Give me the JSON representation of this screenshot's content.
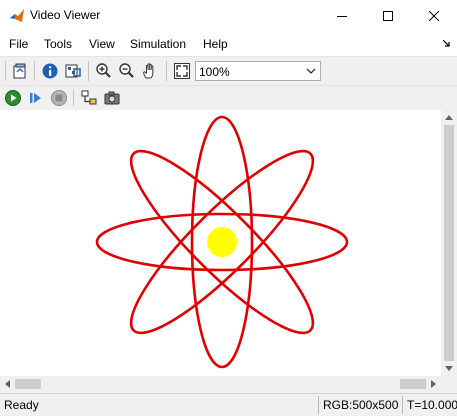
{
  "window": {
    "title": "Video Viewer",
    "app_icon": "matlab-icon",
    "controls": [
      "minimize-icon",
      "maximize-icon",
      "close-icon"
    ]
  },
  "menubar": {
    "items": [
      "File",
      "Tools",
      "View",
      "Simulation",
      "Help"
    ],
    "dock_icon": "dock-arrow-icon"
  },
  "toolbar1": {
    "buttons": [
      "open-icon",
      "info-icon",
      "pixel-region-icon",
      "zoom-in-icon",
      "zoom-out-icon",
      "pan-hand-icon",
      "fit-to-window-icon"
    ],
    "zoom": {
      "value": "100%"
    }
  },
  "toolbar2": {
    "buttons": [
      "run-icon",
      "step-forward-icon",
      "stop-icon",
      "highlight-block-icon",
      "snapshot-camera-icon"
    ]
  },
  "viewer": {
    "image": "atom-graphic",
    "colors": {
      "orbit": "#e00000",
      "nucleus": "#ffff00"
    }
  },
  "status": {
    "ready": "Ready",
    "rgb": "RGB:500x500",
    "time": "T=10.000"
  }
}
